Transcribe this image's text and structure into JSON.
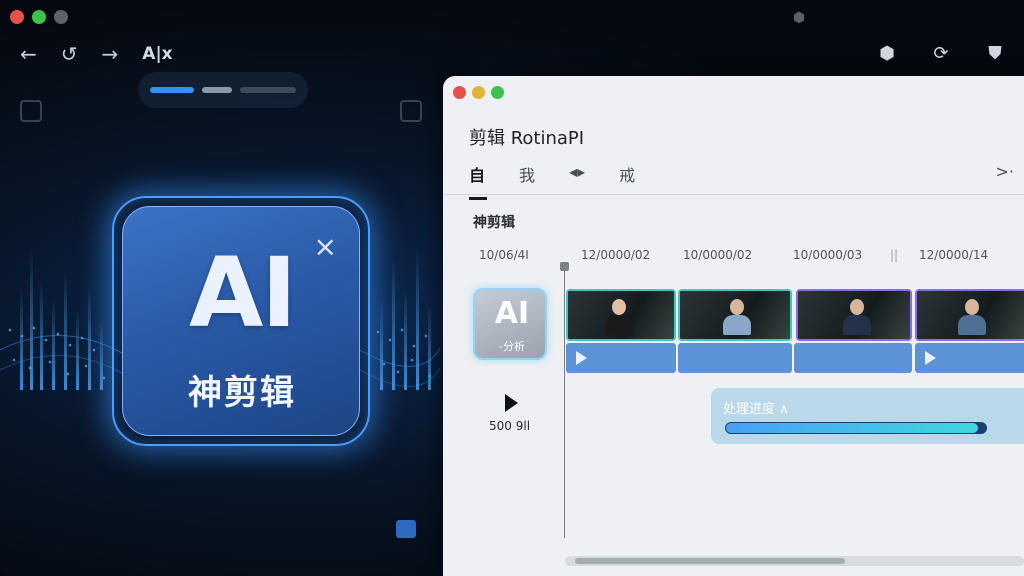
{
  "outer_window": {
    "nav_label": "A|x",
    "icons": {
      "back": "arrow-left-icon",
      "refresh": "refresh-icon",
      "forward": "arrow-right-icon",
      "cube": "cube-icon",
      "sync": "sync-icon",
      "shield": "shield-icon"
    }
  },
  "hero": {
    "ai_text": "AI",
    "subtitle": "神剪辑",
    "close_glyph": "×",
    "accent": "#4a9cff"
  },
  "editor": {
    "title": "剪辑 RotinaPI",
    "tabs": [
      "自",
      "我",
      "◂▸",
      "戒"
    ],
    "active_tab": "自",
    "tab_more": ">·",
    "section_title": "神剪辑",
    "timecodes": [
      "10/06/4I",
      "12/0000/02",
      "10/0000/02",
      "10/0000/03",
      "12/0000/14"
    ],
    "thumb": {
      "ai_text": "AI",
      "label": "-分析"
    },
    "duration": "500 9ll",
    "processing": {
      "label": "处理进度 ∧",
      "progress": 0.97
    },
    "colors": {
      "clip_teal": "#3fc8c2",
      "clip_purple": "#8a6cf0",
      "audio": "#5b93d6"
    }
  }
}
